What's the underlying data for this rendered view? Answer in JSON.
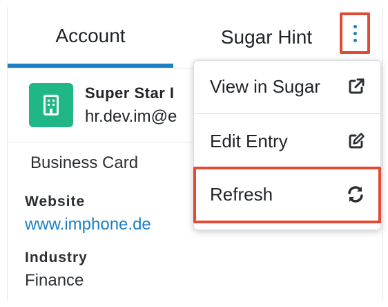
{
  "tabs": {
    "account_label": "Account",
    "hint_label": "Sugar Hint"
  },
  "account": {
    "name": "Super Star I",
    "email": "hr.dev.im@e",
    "icon": "building-icon",
    "icon_color": "#1fb786"
  },
  "details": {
    "section_title": "Business Card",
    "website_label": "Website",
    "website_value": "www.imphone.de",
    "industry_label": "Industry",
    "industry_value": "Finance"
  },
  "menu": {
    "items": [
      {
        "label": "View in Sugar",
        "icon": "external-link-icon"
      },
      {
        "label": "Edit Entry",
        "icon": "edit-icon"
      },
      {
        "label": "Refresh",
        "icon": "refresh-icon"
      }
    ]
  },
  "colors": {
    "accent": "#1d7fc4",
    "highlight": "#e14a33"
  }
}
